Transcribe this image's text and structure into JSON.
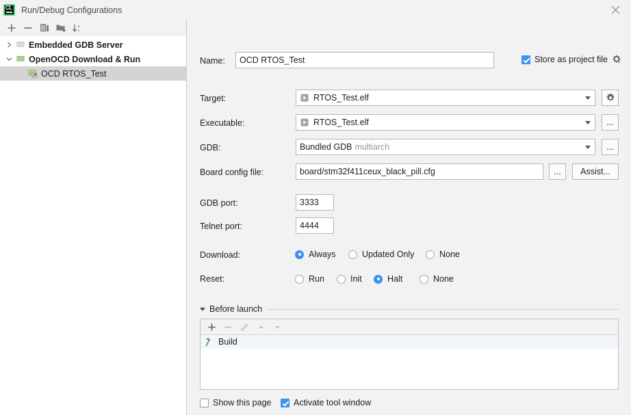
{
  "window": {
    "title": "Run/Debug Configurations",
    "app_icon": "clion-icon",
    "app_icon_text": "CL",
    "close_icon": "close-icon"
  },
  "sidebar": {
    "toolbar": [
      {
        "name": "add-configuration-button",
        "icon": "plus-icon"
      },
      {
        "name": "remove-configuration-button",
        "icon": "minus-icon"
      },
      {
        "name": "copy-configuration-button",
        "icon": "copy-icon"
      },
      {
        "name": "new-folder-button",
        "icon": "folder-add-icon"
      },
      {
        "name": "sort-configurations-button",
        "icon": "sort-alphabetically-icon"
      }
    ],
    "tree": [
      {
        "label": "Embedded GDB Server",
        "expanded": false,
        "selected": false,
        "level": 0,
        "arrow": "chevron-right-icon",
        "icon": "config-type-icon"
      },
      {
        "label": "OpenOCD Download & Run",
        "expanded": true,
        "selected": false,
        "level": 0,
        "arrow": "chevron-down-icon",
        "icon": "config-type-icon"
      },
      {
        "label": "OCD RTOS_Test",
        "expanded": null,
        "selected": true,
        "level": 1,
        "arrow": "",
        "icon": "openocd-config-icon"
      }
    ]
  },
  "main": {
    "name_field": {
      "label": "Name:",
      "value": "OCD RTOS_Test",
      "placeholder": ""
    },
    "store_as_project_file": {
      "label": "Store as project file",
      "checked": true,
      "gear_icon": "gear-dropdown-icon"
    },
    "target": {
      "label": "Target:",
      "value": "RTOS_Test.elf",
      "icon": "run-target-icon",
      "side_button_icon": "gear-icon"
    },
    "executable": {
      "label": "Executable:",
      "value": "RTOS_Test.elf",
      "icon": "run-target-icon",
      "side_button_label": "..."
    },
    "gdb": {
      "label": "GDB:",
      "value": "Bundled GDB",
      "value_suffix": "multiarch",
      "side_button_label": "..."
    },
    "board_config_file": {
      "label": "Board config file:",
      "value": "board/stm32f411ceux_black_pill.cfg",
      "browse_label": "...",
      "assist_label": "Assist..."
    },
    "gdb_port": {
      "label": "GDB port:",
      "value": "3333"
    },
    "telnet_port": {
      "label": "Telnet port:",
      "value": "4444"
    },
    "download": {
      "label": "Download:",
      "options": [
        {
          "label": "Always",
          "selected": true
        },
        {
          "label": "Updated Only",
          "selected": false
        },
        {
          "label": "None",
          "selected": false
        }
      ]
    },
    "reset": {
      "label": "Reset:",
      "options": [
        {
          "label": "Run",
          "selected": false
        },
        {
          "label": "Init",
          "selected": false
        },
        {
          "label": "Halt",
          "selected": true
        },
        {
          "label": "None",
          "selected": false
        }
      ]
    },
    "before_launch": {
      "header": "Before launch",
      "expanded": true,
      "toolbar": [
        {
          "name": "add-task-button",
          "icon": "plus-icon",
          "enabled": true
        },
        {
          "name": "remove-task-button",
          "icon": "minus-icon",
          "enabled": false
        },
        {
          "name": "edit-task-button",
          "icon": "pencil-icon",
          "enabled": false
        },
        {
          "name": "move-task-up-button",
          "icon": "arrow-up-icon",
          "enabled": false
        },
        {
          "name": "move-task-down-button",
          "icon": "arrow-down-icon",
          "enabled": false
        }
      ],
      "tasks": [
        {
          "label": "Build",
          "icon": "hammer-icon",
          "selected": true
        }
      ]
    },
    "show_this_page": {
      "label": "Show this page",
      "checked": false
    },
    "activate_tool_window": {
      "label": "Activate tool window",
      "checked": true
    }
  },
  "colors": {
    "accent": "#3d94f0",
    "window_bg": "#f2f2f2",
    "panel_bg": "#ffffff",
    "tree_selection": "#d4d4d4",
    "list_selection": "#f2f5f9",
    "icon_green": "#6ca750"
  }
}
